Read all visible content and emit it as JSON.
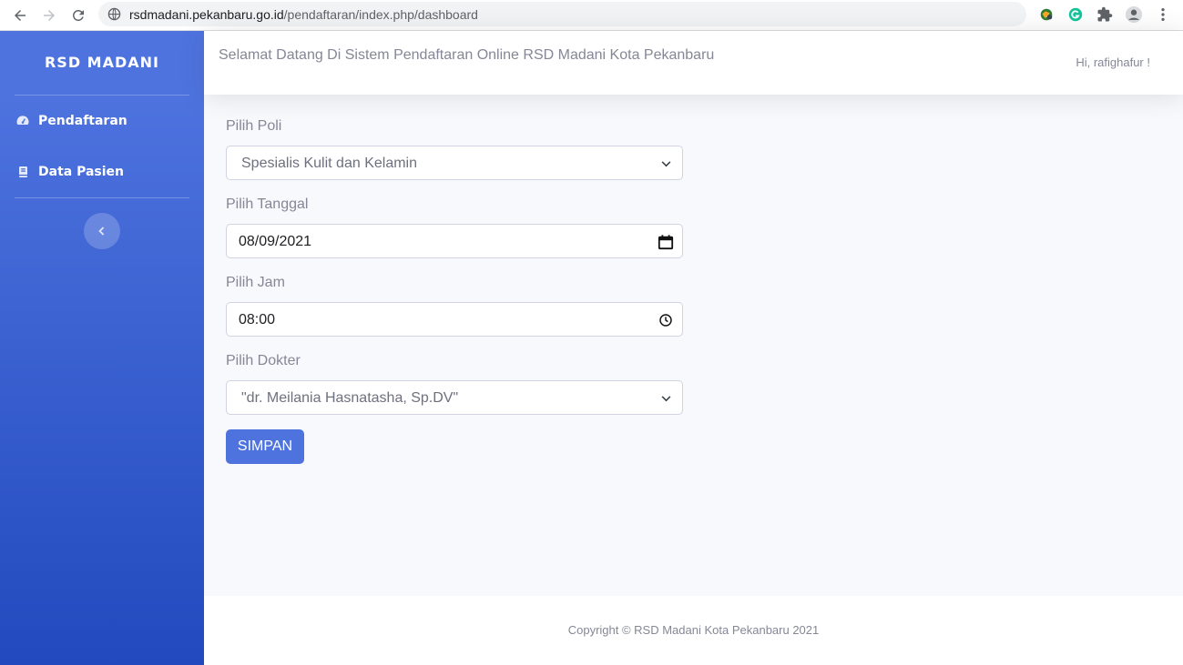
{
  "browser": {
    "url_host": "rsdmadani.pekanbaru.go.id",
    "url_path": "/pendaftaran/index.php/dashboard",
    "icons": [
      "back-icon",
      "forward-icon",
      "reload-icon",
      "site-info-icon",
      "vpn-extension-icon",
      "grammarly-icon",
      "extensions-icon",
      "profile-icon",
      "menu-icon"
    ]
  },
  "sidebar": {
    "brand": "RSD MADANI",
    "items": [
      {
        "label": "Pendaftaran",
        "icon": "tachometer-icon"
      },
      {
        "label": "Data Pasien",
        "icon": "book-icon"
      }
    ],
    "toggle_icon": "chevron-left-icon"
  },
  "topbar": {
    "welcome": "Selamat Datang Di Sistem Pendaftaran Online RSD Madani Kota Pekanbaru",
    "greeting": "Hi, rafighafur !"
  },
  "form": {
    "poli_label": "Pilih Poli",
    "poli_value": "Spesialis Kulit dan Kelamin",
    "tanggal_label": "Pilih Tanggal",
    "tanggal_value": "08/09/2021",
    "jam_label": "Pilih Jam",
    "jam_value": "08:00",
    "dokter_label": "Pilih Dokter",
    "dokter_value": "\"dr. Meilania Hasnatasha, Sp.DV\"",
    "submit_label": "SIMPAN"
  },
  "footer": {
    "copyright": "Copyright © RSD Madani Kota Pekanbaru 2021"
  },
  "colors": {
    "primary": "#4e73df",
    "sidebar_bottom": "#224abe",
    "muted_text": "#858796",
    "page_bg": "#f8f9fc"
  }
}
